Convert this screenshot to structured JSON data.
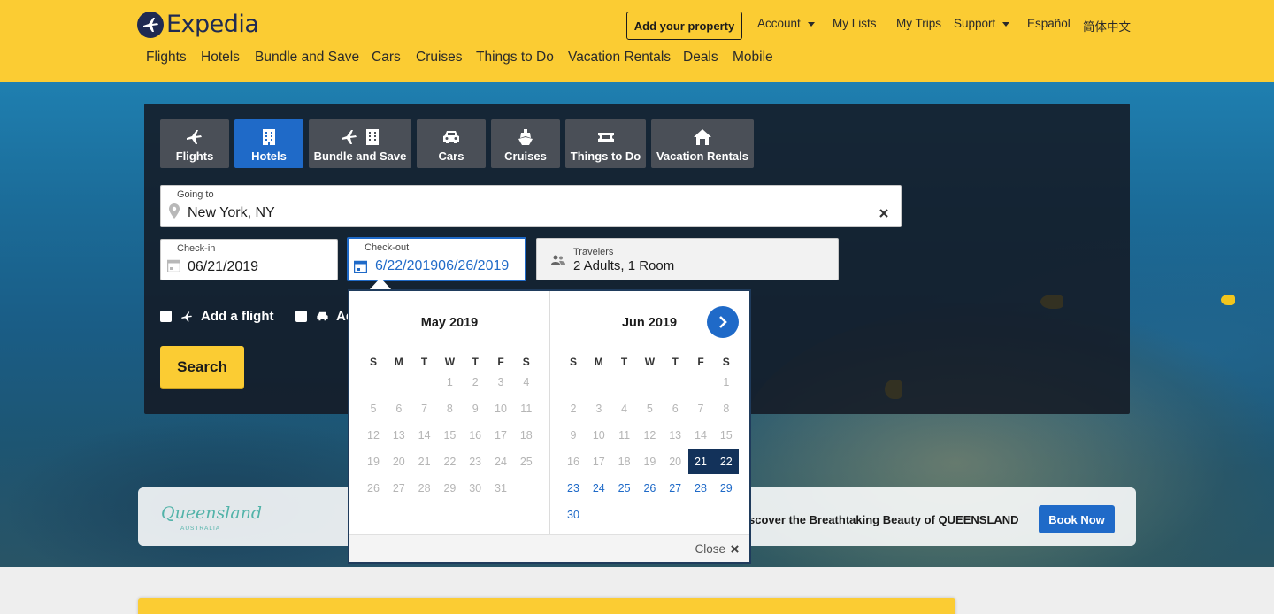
{
  "header": {
    "logo_text": "Expedia",
    "add_property": "Add your property",
    "account": "Account",
    "my_lists": "My Lists",
    "my_trips": "My Trips",
    "support": "Support",
    "espanol": "Español",
    "chinese": "简体中文",
    "nav": [
      "Flights",
      "Hotels",
      "Bundle and Save",
      "Cars",
      "Cruises",
      "Things to Do",
      "Vacation Rentals",
      "Deals",
      "Mobile"
    ]
  },
  "search": {
    "tabs": [
      {
        "label": "Flights",
        "icon": "plane-icon"
      },
      {
        "label": "Hotels",
        "icon": "hotel-icon",
        "active": true
      },
      {
        "label": "Bundle and Save",
        "icon": "bundle-icon"
      },
      {
        "label": "Cars",
        "icon": "car-icon"
      },
      {
        "label": "Cruises",
        "icon": "cruise-icon"
      },
      {
        "label": "Things to Do",
        "icon": "ticket-icon"
      },
      {
        "label": "Vacation Rentals",
        "icon": "house-icon"
      }
    ],
    "going_to_label": "Going to",
    "going_to_value": "New York, NY",
    "checkin_label": "Check-in",
    "checkin_value": "06/21/2019",
    "checkout_label": "Check-out",
    "checkout_value": "6/22/201906/26/2019",
    "travelers_label": "Travelers",
    "travelers_value": "2 Adults, 1 Room",
    "add_flight": "Add a flight",
    "add_car": "Ad",
    "search_button": "Search"
  },
  "calendar": {
    "dow": [
      "S",
      "M",
      "T",
      "W",
      "T",
      "F",
      "S"
    ],
    "months": [
      {
        "title": "May 2019",
        "first_weekday": 3,
        "days": 31,
        "available_from": 32,
        "selected": []
      },
      {
        "title": "Jun 2019",
        "first_weekday": 6,
        "days": 30,
        "available_from": 23,
        "selected": [
          21,
          22
        ]
      }
    ],
    "close_label": "Close"
  },
  "promo": {
    "logo": "Queensland",
    "logo_sub": "AUSTRALIA",
    "text": "scover the Breathtaking Beauty of QUEENSLAND",
    "button": "Book Now"
  },
  "colors": {
    "brand_yellow": "#fbcc33",
    "brand_blue": "#1f6ac8",
    "selected_day": "#13325a",
    "logo_navy": "#1f2a52"
  }
}
